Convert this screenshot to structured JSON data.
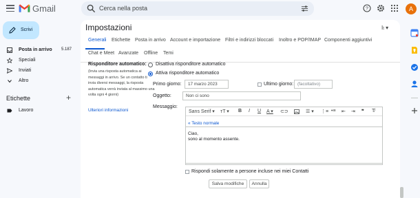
{
  "app": {
    "name": "Gmail"
  },
  "header": {
    "search_placeholder": "Cerca nella posta",
    "avatar_initial": "A"
  },
  "sidebar": {
    "compose_label": "Scrivi",
    "items": [
      {
        "label": "Posta in arrivo",
        "count": "5.187",
        "icon": "inbox-icon"
      },
      {
        "label": "Speciali",
        "count": "",
        "icon": "star-icon"
      },
      {
        "label": "Inviati",
        "count": "",
        "icon": "send-icon"
      },
      {
        "label": "Altro",
        "count": "",
        "icon": "chevron-down-icon"
      }
    ],
    "labels_header": "Etichette",
    "labels": [
      {
        "label": "Lavoro",
        "icon": "label-icon"
      }
    ]
  },
  "settings": {
    "title": "Impostazioni",
    "tabs_row1": [
      "Generali",
      "Etichette",
      "Posta in arrivo",
      "Account e importazione",
      "Filtri e indirizzi bloccati",
      "Inoltro e POP/IMAP",
      "Componenti aggiuntivi"
    ],
    "tabs_row2": [
      "Chat e Meet",
      "Avanzate",
      "Offline",
      "Temi"
    ],
    "active_tab": "Generali",
    "autoreply": {
      "section_label": "Risponditore automatico:",
      "description": "(Invia una risposta automatica ai messaggi in arrivo. Se un contatto ti invia diversi messaggi, la risposta automatica verrà inviata al massimo una volta ogni 4 giorni)",
      "more_info": "Ulteriori informazioni",
      "option_off": "Disattiva risponditore automatico",
      "option_on": "Attiva risponditore automatico",
      "first_day_label": "Primo giorno:",
      "first_day_value": "17 marzo 2023",
      "last_day_label": "Ultimo giorno:",
      "last_day_placeholder": "(facoltativo)",
      "subject_label": "Oggetto:",
      "subject_value": "Non ci sono",
      "message_label": "Messaggio:",
      "font_name": "Sans Serif",
      "plain_text_link": "« Testo normale",
      "message_lines": [
        "Ciao,",
        "sono al momento assente."
      ],
      "contacts_only_label": "Rispondi solamente a persone incluse nei miei Contatti"
    },
    "save_label": "Salva modifiche",
    "cancel_label": "Annulla"
  },
  "colors": {
    "accent": "#0b57d0",
    "compose_bg": "#c2e7ff",
    "avatar_bg": "#e8710a",
    "page_bg": "#f6f8fc"
  }
}
